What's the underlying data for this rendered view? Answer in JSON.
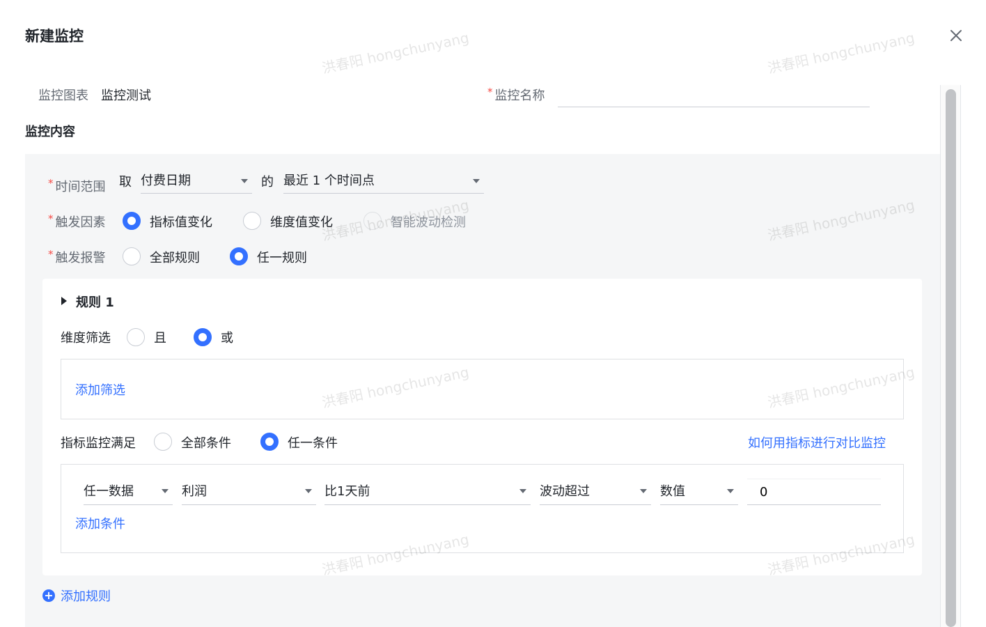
{
  "dialog": {
    "title": "新建监控"
  },
  "watermark": {
    "text": "洪春阳 hongchunyang"
  },
  "form": {
    "chart_label": "监控图表",
    "chart_value": "监控测试",
    "name_label": "监控名称",
    "name_value": "",
    "required_mark": "*"
  },
  "content": {
    "section_title": "监控内容",
    "time_range": {
      "label": "时间范围",
      "take": "取",
      "date_field": "付费日期",
      "of": "的",
      "period": "最近 1 个时间点"
    },
    "trigger_factor": {
      "label": "触发因素",
      "options": [
        "指标值变化",
        "维度值变化",
        "智能波动检测"
      ],
      "selected": "指标值变化"
    },
    "trigger_alarm": {
      "label": "触发报警",
      "options": [
        "全部规则",
        "任一规则"
      ],
      "selected": "任一规则"
    },
    "rule": {
      "title": "规则 1",
      "dimension_filter": {
        "label": "维度筛选",
        "options": [
          "且",
          "或"
        ],
        "selected": "或",
        "add_link": "添加筛选"
      },
      "metric_condition": {
        "label": "指标监控满足",
        "options": [
          "全部条件",
          "任一条件"
        ],
        "selected": "任一条件",
        "help_link": "如何用指标进行对比监控",
        "row": {
          "scope": "任一数据",
          "metric": "利润",
          "compare": "比1天前",
          "operator": "波动超过",
          "type": "数值",
          "value": "0"
        },
        "add_link": "添加条件"
      }
    },
    "add_rule": "添加规则"
  }
}
